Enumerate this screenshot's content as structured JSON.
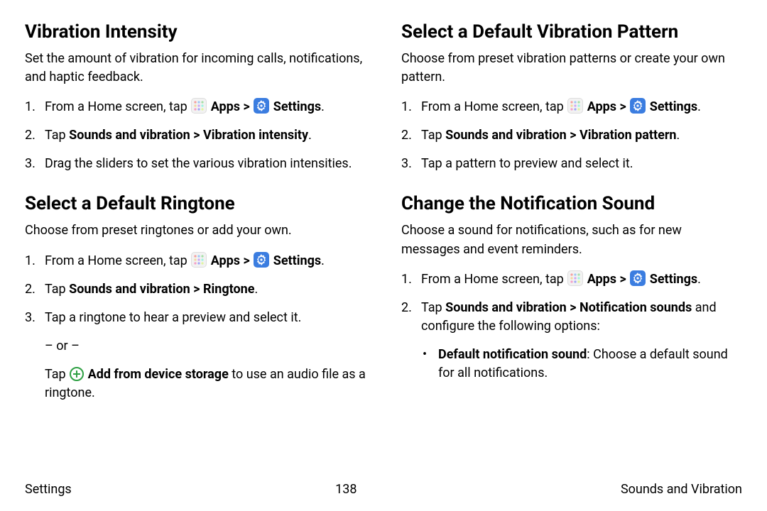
{
  "col_left": {
    "section1": {
      "heading": "Vibration Intensity",
      "intro": "Set the amount of vibration for incoming calls, notifications, and haptic feedback.",
      "step1_prefix": "From a Home screen, tap ",
      "apps_label": "Apps",
      "gt": " > ",
      "settings_label": "Settings",
      "step2_prefix": "Tap ",
      "step2_bold": "Sounds and vibration > Vibration intensity",
      "step3": "Drag the sliders to set the various vibration intensities."
    },
    "section2": {
      "heading": "Select a Default Ringtone",
      "intro": "Choose from preset ringtones or add your own.",
      "step1_prefix": "From a Home screen, tap ",
      "apps_label": "Apps",
      "gt": " > ",
      "settings_label": "Settings",
      "step2_prefix": "Tap ",
      "step2_bold": "Sounds and vibration > Ringtone",
      "step3": "Tap a ringtone to hear a preview and select it.",
      "or": "– or –",
      "alt_prefix": "Tap ",
      "alt_bold": "Add from device storage",
      "alt_suffix": " to use an audio file as a ringtone."
    }
  },
  "col_right": {
    "section1": {
      "heading": "Select a Default Vibration Pattern",
      "intro": "Choose from preset vibration patterns or create your own pattern.",
      "step1_prefix": "From a Home screen, tap ",
      "apps_label": "Apps",
      "gt": " > ",
      "settings_label": "Settings",
      "step2_prefix": "Tap ",
      "step2_bold": "Sounds and vibration > Vibration pattern",
      "step3": "Tap a pattern to preview and select it."
    },
    "section2": {
      "heading": "Change the Notification Sound",
      "intro": "Choose a sound for notifications, such as for new messages and event reminders.",
      "step1_prefix": "From a Home screen, tap ",
      "apps_label": "Apps",
      "gt": " > ",
      "settings_label": "Settings",
      "step2_prefix": "Tap ",
      "step2_bold": "Sounds and vibration > Notification sounds",
      "step2_suffix": " and configure the following options:",
      "bullet1_bold": "Default notification sound",
      "bullet1_rest": ": Choose a default sound for all notifications."
    }
  },
  "footer": {
    "left": "Settings",
    "center": "138",
    "right": "Sounds and Vibration"
  }
}
